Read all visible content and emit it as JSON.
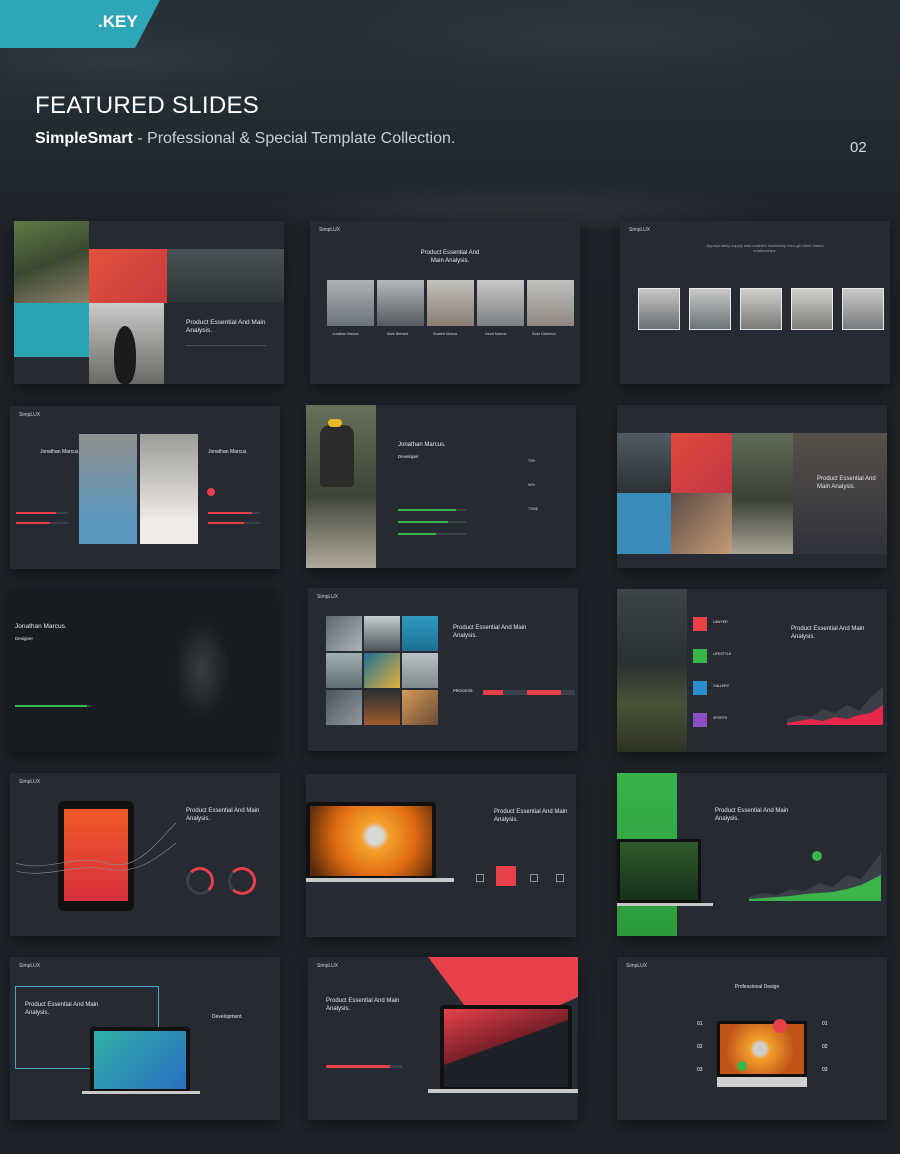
{
  "badge": {
    "label": ".KEY",
    "color": "#2ea6b8"
  },
  "header": {
    "title": "FEATURED SLIDES",
    "brand": "SimpleSmart",
    "separator": " - ",
    "tagline": "Professional & Special Template Collection.",
    "page": "02"
  },
  "colors": {
    "red": "#e8414a",
    "teal": "#2aa3b5",
    "green": "#3ab54a",
    "background": "#1f2429",
    "card": "#252a33"
  },
  "slides": {
    "s1": {
      "heading": "Product Essential And Main Analysis."
    },
    "s2": {
      "heading": "Product Essential And Main Analysis.",
      "names": [
        "Jonathan Marcus",
        "Mark Bernard",
        "Scarlett Marcus",
        "David Marcus",
        "Sean Davidson"
      ]
    },
    "s3": {
      "heading": "Appropriately supply web-enabled leadership through client based relationships."
    },
    "s4": {
      "name_left": "Jonathan Marcus",
      "name_right": "Jonathan Marcus"
    },
    "s5": {
      "name": "Jonathan Marcus.",
      "role": "Developer",
      "stats": [
        "70%",
        "50%",
        "7000$"
      ]
    },
    "s6": {
      "heading": "Product Essential And Main Analysis."
    },
    "s7": {
      "name": "Jonathan Marcus.",
      "role": "Designer"
    },
    "s8": {
      "heading": "Product Essential And Main Analysis.",
      "process": "PROCESS"
    },
    "s9": {
      "heading": "Product Essential And Main Analysis.",
      "items": [
        "LAWYER",
        "LIFESTYLE",
        "GALLERY",
        "SPORTS"
      ]
    },
    "s10": {
      "heading": "Product Essential And Main Analysis."
    },
    "s11": {
      "heading": "Product Essential And Main Analysis."
    },
    "s12": {
      "heading": "Product Essential And Main Analysis."
    },
    "s13": {
      "heading": "Product Essential And Main Analysis.",
      "side": "Development."
    },
    "s14": {
      "heading": "Product Essential And Main Analysis."
    },
    "s15": {
      "heading": "Professional Design",
      "numbers": [
        "01",
        "02",
        "03",
        "01",
        "02",
        "03"
      ]
    }
  }
}
